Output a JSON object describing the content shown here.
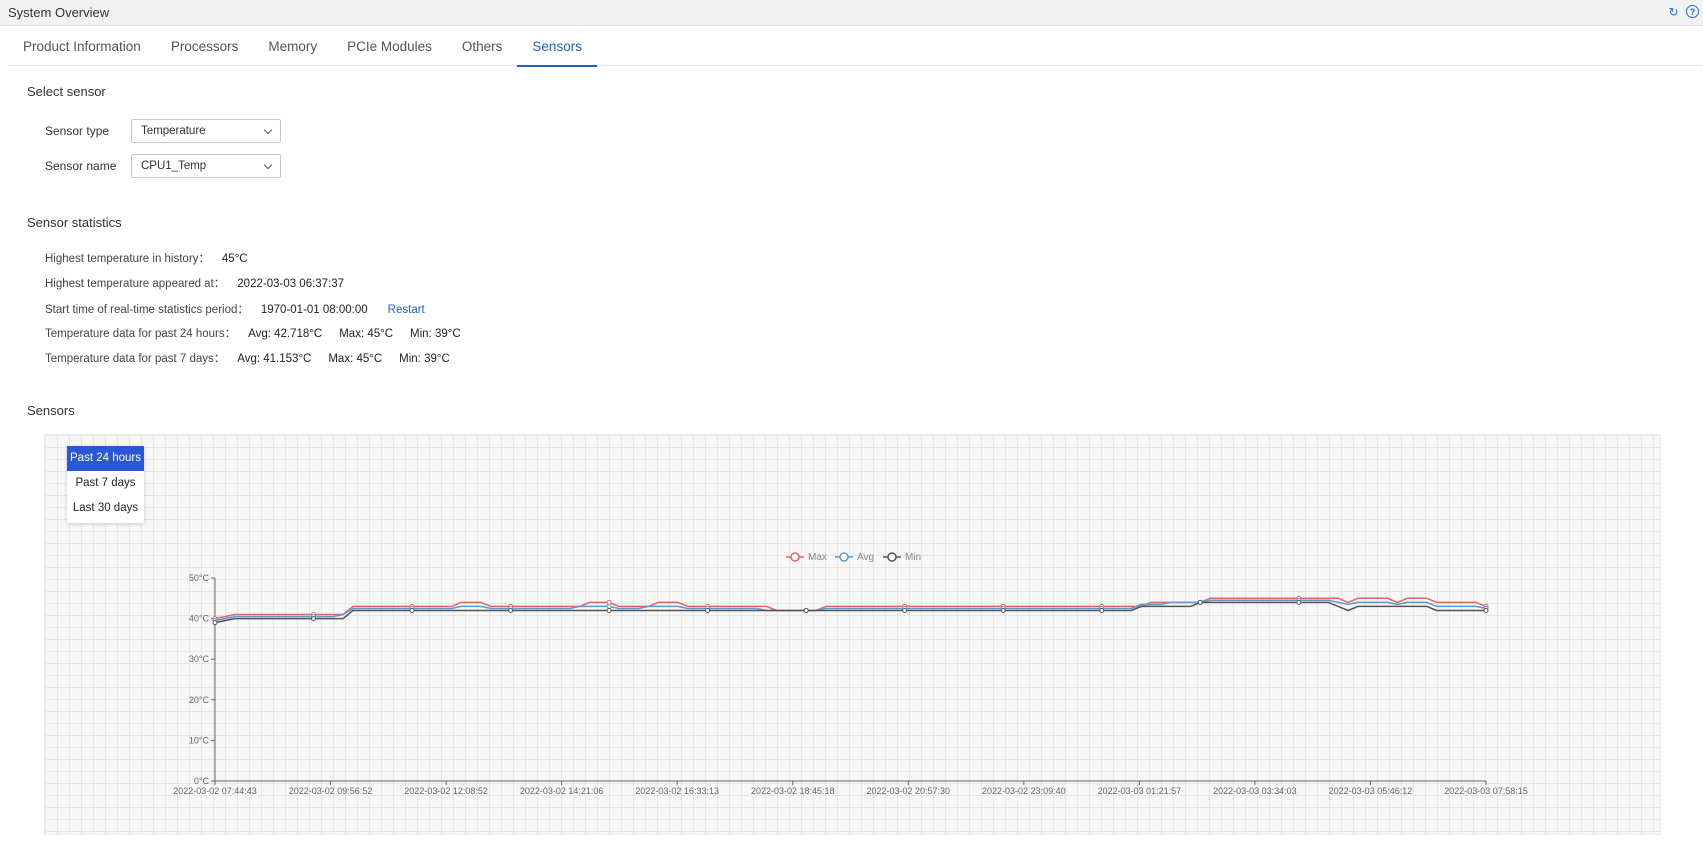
{
  "header": {
    "title": "System Overview",
    "refresh_icon": "refresh-icon",
    "help_icon": "help-icon",
    "help_glyph": "?"
  },
  "tabs": [
    {
      "label": "Product Information",
      "active": false
    },
    {
      "label": "Processors",
      "active": false
    },
    {
      "label": "Memory",
      "active": false
    },
    {
      "label": "PCIe Modules",
      "active": false
    },
    {
      "label": "Others",
      "active": false
    },
    {
      "label": "Sensors",
      "active": true
    }
  ],
  "select_sensor": {
    "title": "Select sensor",
    "type_label": "Sensor type",
    "type_value": "Temperature",
    "name_label": "Sensor name",
    "name_value": "CPU1_Temp"
  },
  "statistics": {
    "title": "Sensor statistics",
    "highest_label": "Highest temperature in history：",
    "highest_value": "45°C",
    "appeared_label": "Highest temperature appeared at：",
    "appeared_value": "2022-03-03 06:37:37",
    "start_label": "Start time of real-time statistics period：",
    "start_value": "1970-01-01 08:00:00",
    "restart_label": "Restart",
    "day_label": "Temperature data for past 24 hours：",
    "day_avg": "Avg: 42.718°C",
    "day_max": "Max: 45°C",
    "day_min": "Min: 39°C",
    "week_label": "Temperature data for past 7 days：",
    "week_avg": "Avg: 41.153°C",
    "week_max": "Max: 45°C",
    "week_min": "Min: 39°C"
  },
  "sensors_section": {
    "title": "Sensors",
    "ranges": [
      {
        "label": "Past 24 hours",
        "active": true
      },
      {
        "label": "Past 7 days",
        "active": false
      },
      {
        "label": "Last 30 days",
        "active": false
      }
    ]
  },
  "colors": {
    "accent": "#1f5fbf",
    "max": "#e06666",
    "avg": "#5b9bd5",
    "min": "#555555"
  },
  "chart_data": {
    "type": "line",
    "ylim": [
      0,
      50
    ],
    "yticks": [
      0,
      10,
      20,
      30,
      40,
      50
    ],
    "y_unit": "°C",
    "x_tick_labels": [
      "2022-03-02 07:44:43",
      "2022-03-02 09:56:52",
      "2022-03-02 12:08:52",
      "2022-03-02 14:21:06",
      "2022-03-02 16:33:13",
      "2022-03-02 18:45:18",
      "2022-03-02 20:57:30",
      "2022-03-02 23:09:40",
      "2022-03-03 01:21:57",
      "2022-03-03 03:34:03",
      "2022-03-03 05:46:12",
      "2022-03-03 07:58:15"
    ],
    "legend_position": "top-center",
    "grid": true,
    "series": [
      {
        "name": "Max",
        "values": [
          40,
          40.5,
          41,
          41,
          41,
          41,
          41,
          41,
          41,
          41,
          41,
          41,
          41,
          41,
          43,
          43,
          43,
          43,
          43,
          43,
          43,
          43,
          43,
          43,
          43,
          44,
          44,
          44,
          43,
          43,
          43,
          43,
          43,
          43,
          43,
          43,
          43,
          43,
          44,
          44,
          44,
          43,
          43,
          43,
          43,
          44,
          44,
          44,
          43,
          43,
          43,
          43,
          43,
          43,
          43,
          43,
          43,
          42,
          42,
          42,
          42,
          42,
          43,
          43,
          43,
          43,
          43,
          43,
          43,
          43,
          43,
          43,
          43,
          43,
          43,
          43,
          43,
          43,
          43,
          43,
          43,
          43,
          43,
          43,
          43,
          43,
          43,
          43,
          43,
          43,
          43,
          43,
          43,
          43,
          43,
          44,
          44,
          44,
          44,
          44,
          44,
          45,
          45,
          45,
          45,
          45,
          45,
          45,
          45,
          45,
          45,
          45,
          45,
          45,
          45,
          44,
          45,
          45,
          45,
          45,
          44,
          45,
          45,
          45,
          44,
          44,
          44,
          44,
          44,
          43
        ]
      },
      {
        "name": "Avg",
        "values": [
          39.5,
          40,
          40.5,
          40.5,
          40.5,
          40.5,
          40.5,
          40.5,
          40.5,
          40.5,
          40.5,
          40.5,
          40.5,
          41,
          42.5,
          42.5,
          42.5,
          42.5,
          42.5,
          42.5,
          42.5,
          42.5,
          42.5,
          42.5,
          42.5,
          43,
          43,
          43,
          42.5,
          42.5,
          42.5,
          42.5,
          42.5,
          42.5,
          42.5,
          42.5,
          42.5,
          43,
          43,
          43,
          43,
          42.5,
          42.5,
          42.5,
          43,
          43,
          43,
          43,
          42.5,
          42.5,
          42.5,
          42.5,
          42.5,
          42.5,
          42.5,
          42.5,
          42,
          42,
          42,
          42,
          42,
          42,
          42.5,
          42.5,
          42.5,
          42.5,
          42.5,
          42.5,
          42.5,
          42.5,
          42.5,
          42.5,
          42.5,
          42.5,
          42.5,
          42.5,
          42.5,
          42.5,
          42.5,
          42.5,
          42.5,
          42.5,
          42.5,
          42.5,
          42.5,
          42.5,
          42.5,
          42.5,
          42.5,
          42.5,
          42.5,
          42.5,
          42.5,
          42.5,
          43.5,
          43.5,
          43.5,
          44,
          44,
          44,
          44,
          44.5,
          44.5,
          44.5,
          44.5,
          44.5,
          44.5,
          44.5,
          44.5,
          44.5,
          44.5,
          44.5,
          44.5,
          44.5,
          44,
          43.5,
          44,
          44,
          44,
          44,
          43.5,
          44,
          44,
          44,
          43,
          43,
          43,
          43,
          43,
          42.5
        ]
      },
      {
        "name": "Min",
        "values": [
          39,
          39.5,
          40,
          40,
          40,
          40,
          40,
          40,
          40,
          40,
          40,
          40,
          40,
          40,
          42,
          42,
          42,
          42,
          42,
          42,
          42,
          42,
          42,
          42,
          42,
          42,
          42,
          42,
          42,
          42,
          42,
          42,
          42,
          42,
          42,
          42,
          42,
          42,
          42,
          42,
          42,
          42,
          42,
          42,
          42,
          42,
          42,
          42,
          42,
          42,
          42,
          42,
          42,
          42,
          42,
          42,
          42,
          42,
          42,
          42,
          42,
          42,
          42,
          42,
          42,
          42,
          42,
          42,
          42,
          42,
          42,
          42,
          42,
          42,
          42,
          42,
          42,
          42,
          42,
          42,
          42,
          42,
          42,
          42,
          42,
          42,
          42,
          42,
          42,
          42,
          42,
          42,
          42,
          42,
          43,
          43,
          43,
          43,
          43,
          43,
          44,
          44,
          44,
          44,
          44,
          44,
          44,
          44,
          44,
          44,
          44,
          44,
          44,
          44,
          43,
          42,
          43,
          43,
          43,
          43,
          43,
          43,
          43,
          43,
          42,
          42,
          42,
          42,
          42,
          42
        ]
      }
    ]
  }
}
